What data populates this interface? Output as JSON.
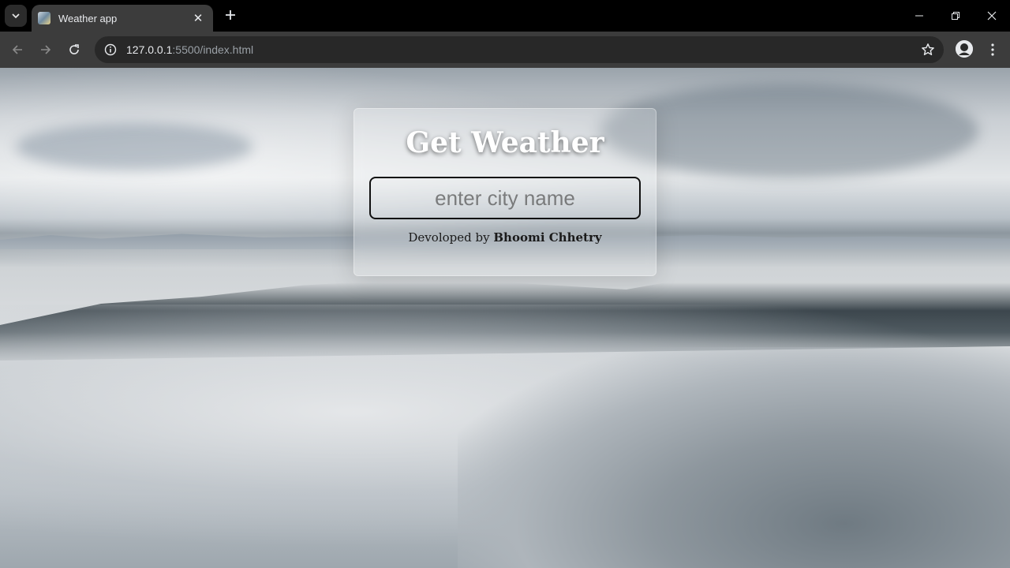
{
  "browser": {
    "tab_title": "Weather app",
    "url_host": "127.0.0.1",
    "url_path": ":5500/index.html"
  },
  "page": {
    "heading": "Get Weather",
    "input_placeholder": "enter city name",
    "input_value": "",
    "credit_prefix": "Devoloped by",
    "credit_name": "Bhoomi Chhetry"
  },
  "icons": {
    "tab_search": "chevron-down-icon",
    "tab_close": "close-icon",
    "new_tab": "plus-icon",
    "back": "back-arrow-icon",
    "forward": "forward-arrow-icon",
    "reload": "reload-icon",
    "site_info": "info-icon",
    "bookmark": "star-icon",
    "profile": "profile-avatar-icon",
    "menu": "kebab-menu-icon"
  }
}
